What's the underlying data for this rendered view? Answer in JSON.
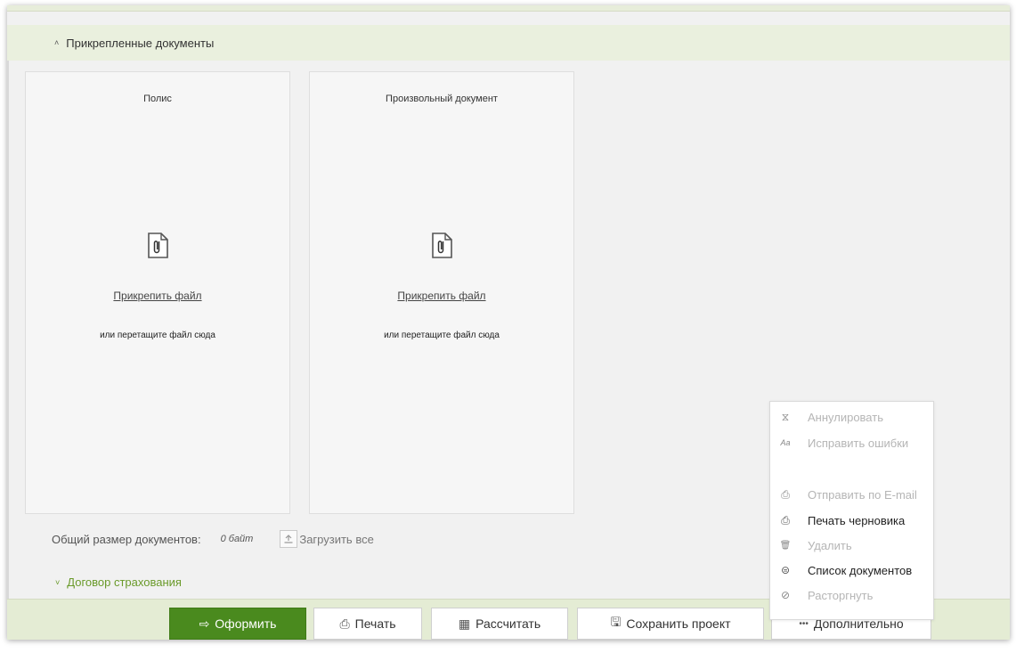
{
  "attachments": {
    "header": {
      "toggle_glyph": "˄",
      "title": "Прикрепленные документы"
    },
    "cards": [
      {
        "title": "Полис",
        "icon": "paperclip-file-icon",
        "attach_link": "Прикрепить файл",
        "drop_hint": "или перетащите файл сюда"
      },
      {
        "title": "Произвольный документ",
        "icon": "paperclip-file-icon",
        "attach_link": "Прикрепить файл",
        "drop_hint": "или перетащите файл сюда"
      }
    ],
    "summary": {
      "label": "Общий размер документов:",
      "value": "0 байт",
      "upload_all": "Загрузить все"
    }
  },
  "contract_section": {
    "toggle_glyph": "˅",
    "title": "Договор страхования"
  },
  "more_menu": {
    "items": [
      {
        "label": "Аннулировать",
        "icon": "hourglass-icon",
        "glyph": "⧖",
        "enabled": false
      },
      {
        "label": "Исправить ошибки",
        "icon": "spellcheck-icon",
        "glyph": "Aa",
        "enabled": false
      },
      {
        "label": "Отправить по E-mail",
        "icon": "printer-icon",
        "glyph": "⎙",
        "enabled": false
      },
      {
        "label": "Печать черновика",
        "icon": "printer-icon",
        "glyph": "⎙",
        "enabled": true
      },
      {
        "label": "Удалить",
        "icon": "trash-icon",
        "glyph": "🗑",
        "enabled": false
      },
      {
        "label": "Список документов",
        "icon": "document-list-icon",
        "glyph": "⊜",
        "enabled": true
      },
      {
        "label": "Расторгнуть",
        "icon": "cancel-contract-icon",
        "glyph": "⊘",
        "enabled": false
      }
    ]
  },
  "footer": {
    "buttons": [
      {
        "label": "Оформить",
        "icon": "arrow-right-icon",
        "glyph": "⇨",
        "primary": true
      },
      {
        "label": "Печать",
        "icon": "printer-icon",
        "glyph": "⎙",
        "primary": false
      },
      {
        "label": "Рассчитать",
        "icon": "calculator-icon",
        "glyph": "▦",
        "primary": false
      },
      {
        "label": "Сохранить проект",
        "icon": "save-icon",
        "glyph": "🖫",
        "primary": false
      },
      {
        "label": "Дополнительно",
        "icon": "more-dots-icon",
        "glyph": "•••",
        "primary": false
      }
    ]
  },
  "colors": {
    "accent": "#4a8a1e",
    "header_bg": "#eaf0de",
    "footer_bg": "#e4ecd4",
    "link_green": "#6a9a2a"
  }
}
